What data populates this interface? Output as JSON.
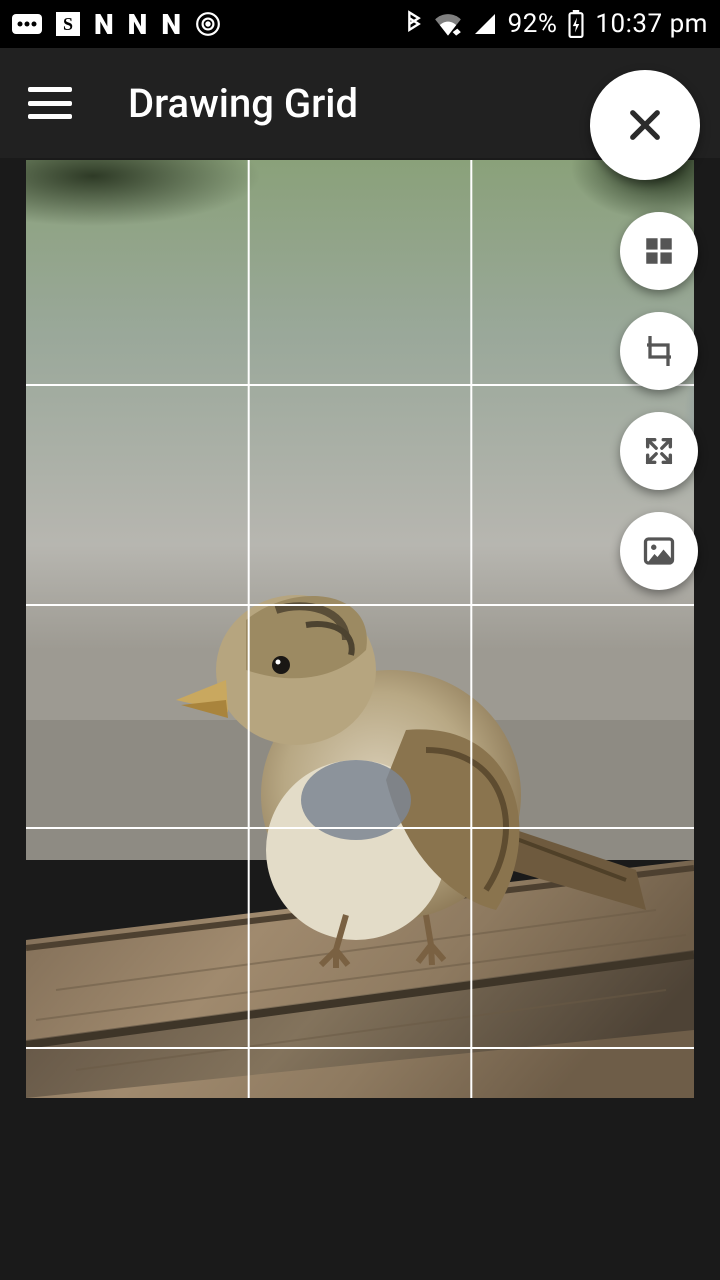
{
  "status_bar": {
    "battery_percent": "92%",
    "time": "10:37 pm",
    "left_icons": [
      "more",
      "s",
      "n",
      "n",
      "n",
      "spiral"
    ],
    "right_icons": [
      "bluetooth",
      "wifi",
      "signal",
      "battery-charging"
    ]
  },
  "app_bar": {
    "title": "Drawing Grid",
    "menu_icon": "menu"
  },
  "fab": {
    "close": "close",
    "grid": "grid",
    "crop": "crop",
    "expand": "expand",
    "image": "image"
  },
  "canvas": {
    "grid_columns": 3,
    "grid_rows_visible": 5,
    "image_alt": "bird on wood"
  }
}
